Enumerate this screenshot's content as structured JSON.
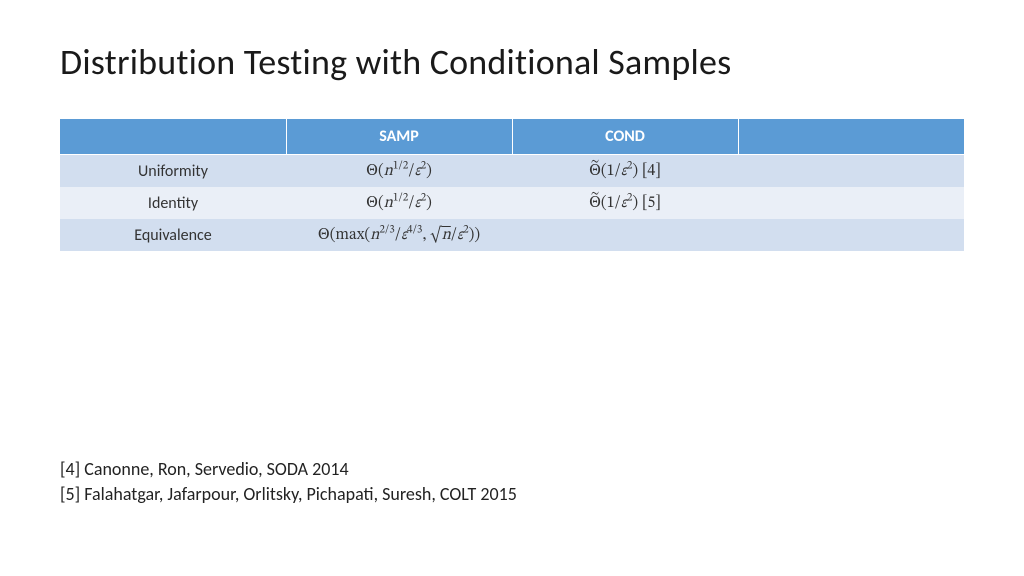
{
  "title": "Distribution Testing with Conditional Samples",
  "table": {
    "headers": [
      "",
      "SAMP",
      "COND",
      ""
    ],
    "rows": [
      {
        "label": "Uniformity",
        "samp": "Θ(n^{1/2}/ε^2)",
        "cond": "Θ̃(1/ε^2) [4]"
      },
      {
        "label": "Identity",
        "samp": "Θ(n^{1/2}/ε^2)",
        "cond": "Θ̃(1/ε^2) [5]"
      },
      {
        "label": "Equivalence",
        "samp": "Θ(max(n^{2/3}/ε^{4/3}, √n/ε^2))",
        "cond": ""
      }
    ]
  },
  "chart_data": {
    "type": "table",
    "columns": [
      "",
      "SAMP",
      "COND"
    ],
    "rows": [
      [
        "Uniformity",
        "Θ(n^{1/2}/ε^2)",
        "Θ̃(1/ε^2) [4]"
      ],
      [
        "Identity",
        "Θ(n^{1/2}/ε^2)",
        "Θ̃(1/ε^2) [5]"
      ],
      [
        "Equivalence",
        "Θ(max(n^{2/3}/ε^{4/3}, √n/ε^2))",
        ""
      ]
    ]
  },
  "references": [
    "[4] Canonne, Ron, Servedio, SODA 2014",
    "[5] Falahatgar, Jafarpour, Orlitsky, Pichapati, Suresh, COLT 2015"
  ]
}
